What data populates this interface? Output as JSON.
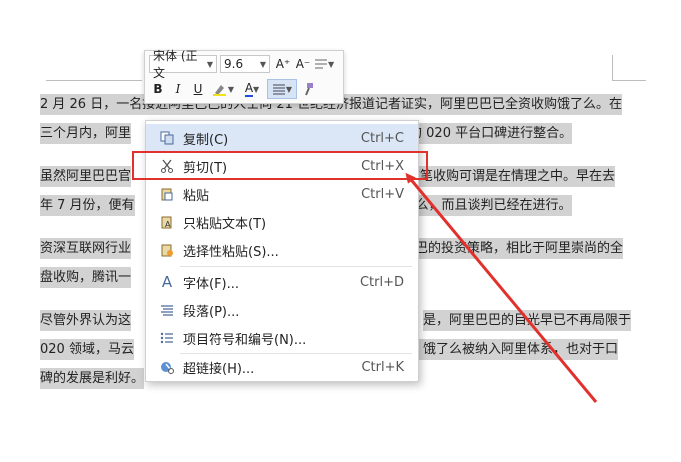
{
  "paragraphs": [
    [
      "2 月 26 日，一名接近阿里巴巴的人士向 21 世纪经济报道记者证实，阿里巴巴已全资收购饿了么。在",
      "三个月内，阿里",
      "旗下的 020 平台口碑进行整合。"
    ],
    [
      "虽然阿里巴巴官",
      "这笔收购可谓是在情理之中。早在去",
      "年 7 月份，便有",
      "么，而且谈判已经在进行。"
    ],
    [
      "资深互联网行业",
      "巴巴的投资策略，相比于阿里崇尚的全",
      "盘收购，腾讯一"
    ],
    [
      "尽管外界认为这",
      "是，阿里巴巴的目光早已不再局限于",
      "020 领域，马云",
      "，饿了么被纳入阿里体系，也对于口",
      "碑的发展是利好。"
    ]
  ],
  "toolbar": {
    "font_name": "宋体 (正文",
    "font_size": "9.6",
    "grow_font": "A⁺",
    "shrink_font": "A⁻",
    "bold": "B",
    "italic": "I",
    "underline": "U",
    "font_color_letter": "A",
    "font_color": "#1f4fd6"
  },
  "context_menu": {
    "items": [
      {
        "label": "复制(C)",
        "shortcut": "Ctrl+C",
        "icon": "copy-icon"
      },
      {
        "label": "剪切(T)",
        "shortcut": "Ctrl+X",
        "icon": "scissors-icon"
      },
      {
        "label": "粘贴",
        "shortcut": "Ctrl+V",
        "icon": "paste-icon"
      },
      {
        "label": "只粘贴文本(T)",
        "shortcut": "",
        "icon": "paste-text-icon"
      },
      {
        "label": "选择性粘贴(S)...",
        "shortcut": "",
        "icon": "paste-special-icon"
      },
      {
        "label": "字体(F)...",
        "shortcut": "Ctrl+D",
        "icon": "font-icon"
      },
      {
        "label": "段落(P)...",
        "shortcut": "",
        "icon": "paragraph-icon"
      },
      {
        "label": "项目符号和编号(N)...",
        "shortcut": "",
        "icon": "bullet-list-icon"
      },
      {
        "label": "超链接(H)...",
        "shortcut": "Ctrl+K",
        "icon": "hyperlink-icon"
      }
    ],
    "active_item": "复制(C)",
    "highlighted_item": "剪切(T)"
  },
  "colors": {
    "highlight_box": "#e0312d",
    "selection": "#d2d2d2",
    "menu_hover": "#dbe7f7"
  }
}
